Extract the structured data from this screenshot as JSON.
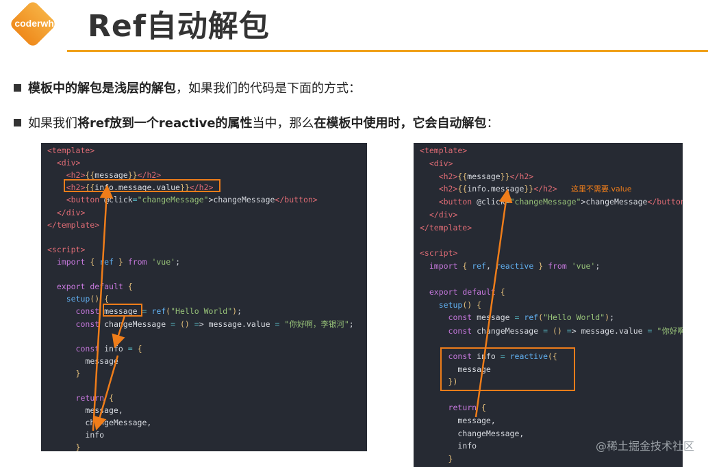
{
  "logo": {
    "text": "coderwhy"
  },
  "title": "Ref自动解包",
  "bullets": [
    {
      "parts": [
        {
          "b": true,
          "t": "模板中的解包是浅层的解包"
        },
        {
          "b": false,
          "t": "，如果我们的代码是下面的方式："
        }
      ]
    },
    {
      "parts": [
        {
          "b": false,
          "t": "如果我们"
        },
        {
          "b": true,
          "t": "将ref放到一个reactive的属性"
        },
        {
          "b": false,
          "t": "当中，那么"
        },
        {
          "b": true,
          "t": "在模板中使用时，它会自动解包"
        },
        {
          "b": false,
          "t": "："
        }
      ]
    }
  ],
  "left_code": [
    "<template>",
    "  <div>",
    "    <h2>{{message}}</h2>",
    "    <h2>{{info.message.value}}</h2>",
    "    <button @click=\"changeMessage\">changeMessage</button>",
    "  </div>",
    "</template>",
    "",
    "<script>",
    "  import { ref } from 'vue';",
    "",
    "  export default {",
    "    setup() {",
    "      const message = ref(\"Hello World\");",
    "      const changeMessage = () => message.value = \"你好啊，李银河\";",
    "",
    "      const info = {",
    "        message",
    "      }",
    "",
    "      return {",
    "        message,",
    "        changeMessage,",
    "        info",
    "      }"
  ],
  "right_code": [
    "<template>",
    "  <div>",
    "    <h2>{{message}}</h2>",
    "    <h2>{{info.message}}</h2>",
    "    <button @click=\"changeMessage\">changeMessage</button>",
    "  </div>",
    "</template>",
    "",
    "<script>",
    "  import { ref, reactive } from 'vue';",
    "",
    "  export default {",
    "    setup() {",
    "      const message = ref(\"Hello World\");",
    "      const changeMessage = () => message.value = \"你好啊，李银河\";",
    "",
    "      const info = reactive({",
    "        message",
    "      })",
    "",
    "      return {",
    "        message,",
    "        changeMessage,",
    "        info",
    "      }"
  ],
  "right_note": "这里不需要.value",
  "watermark": "@稀土掘金技术社区",
  "colors": {
    "accent": "#ef7d1a",
    "rule": "#f0a11a",
    "code_bg": "#262a33"
  }
}
